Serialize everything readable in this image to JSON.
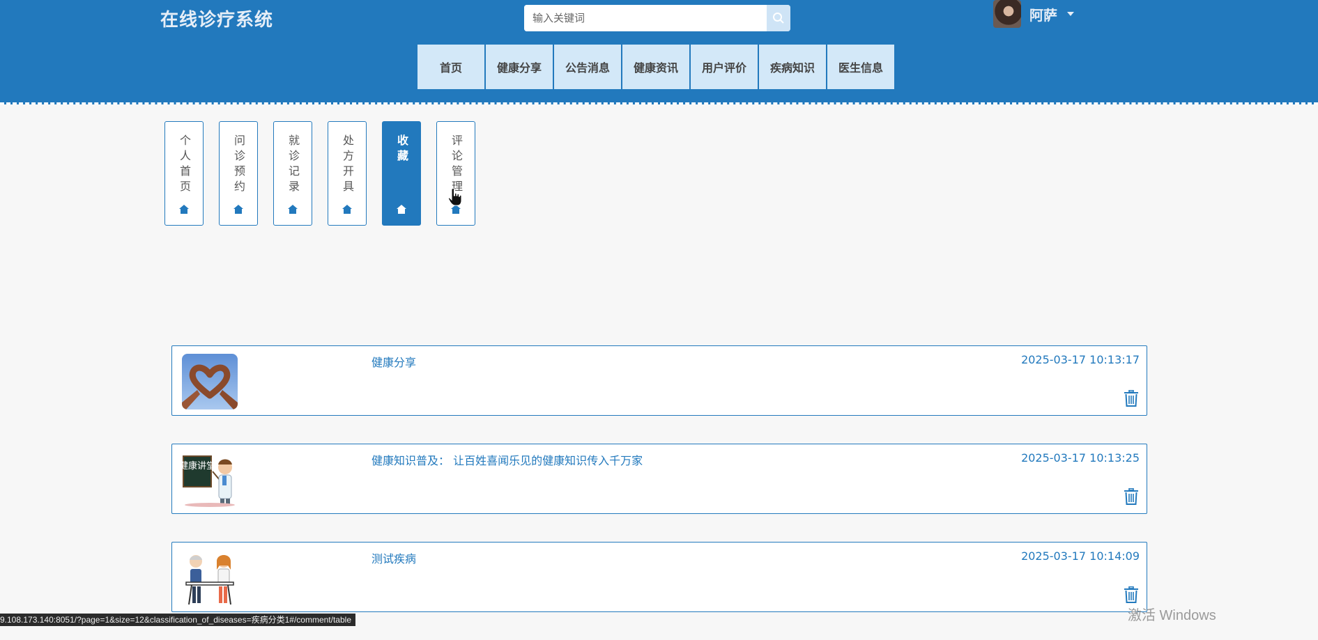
{
  "header": {
    "site_title": "在线诊疗系统",
    "search_placeholder": "输入关键词",
    "user_name": "阿萨"
  },
  "nav": {
    "items": [
      "首页",
      "健康分享",
      "公告消息",
      "健康资讯",
      "用户评价",
      "疾病知识",
      "医生信息"
    ]
  },
  "side_tabs": {
    "items": [
      {
        "label": "个人首页",
        "active": false
      },
      {
        "label": "问诊预约",
        "active": false
      },
      {
        "label": "就诊记录",
        "active": false
      },
      {
        "label": "处方开具",
        "active": false
      },
      {
        "label": "收藏",
        "active": true
      },
      {
        "label": "评论管理",
        "active": false
      }
    ]
  },
  "favorites": [
    {
      "title": "健康分享",
      "time": "2025-03-17 10:13:17",
      "thumb_icon": "heart-hands-photo"
    },
    {
      "title": "健康知识普及： 让百姓喜闻乐见的健康知识传入千万家",
      "time": "2025-03-17 10:13:25",
      "thumb_icon": "health-lecture-cartoon",
      "thumb_text": "健康讲堂"
    },
    {
      "title": "测试疾病",
      "time": "2025-03-17 10:14:09",
      "thumb_icon": "doctor-patient-cartoon"
    }
  ],
  "status_bar": {
    "url": "9.108.173.140:8051/?page=1&size=12&classification_of_diseases=疾病分类1#/comment/table"
  },
  "watermark": {
    "text": "激活 Windows"
  },
  "colors": {
    "primary": "#2279bd",
    "nav_bg": "#d3e8f8",
    "page_bg": "#f7f7f7"
  }
}
